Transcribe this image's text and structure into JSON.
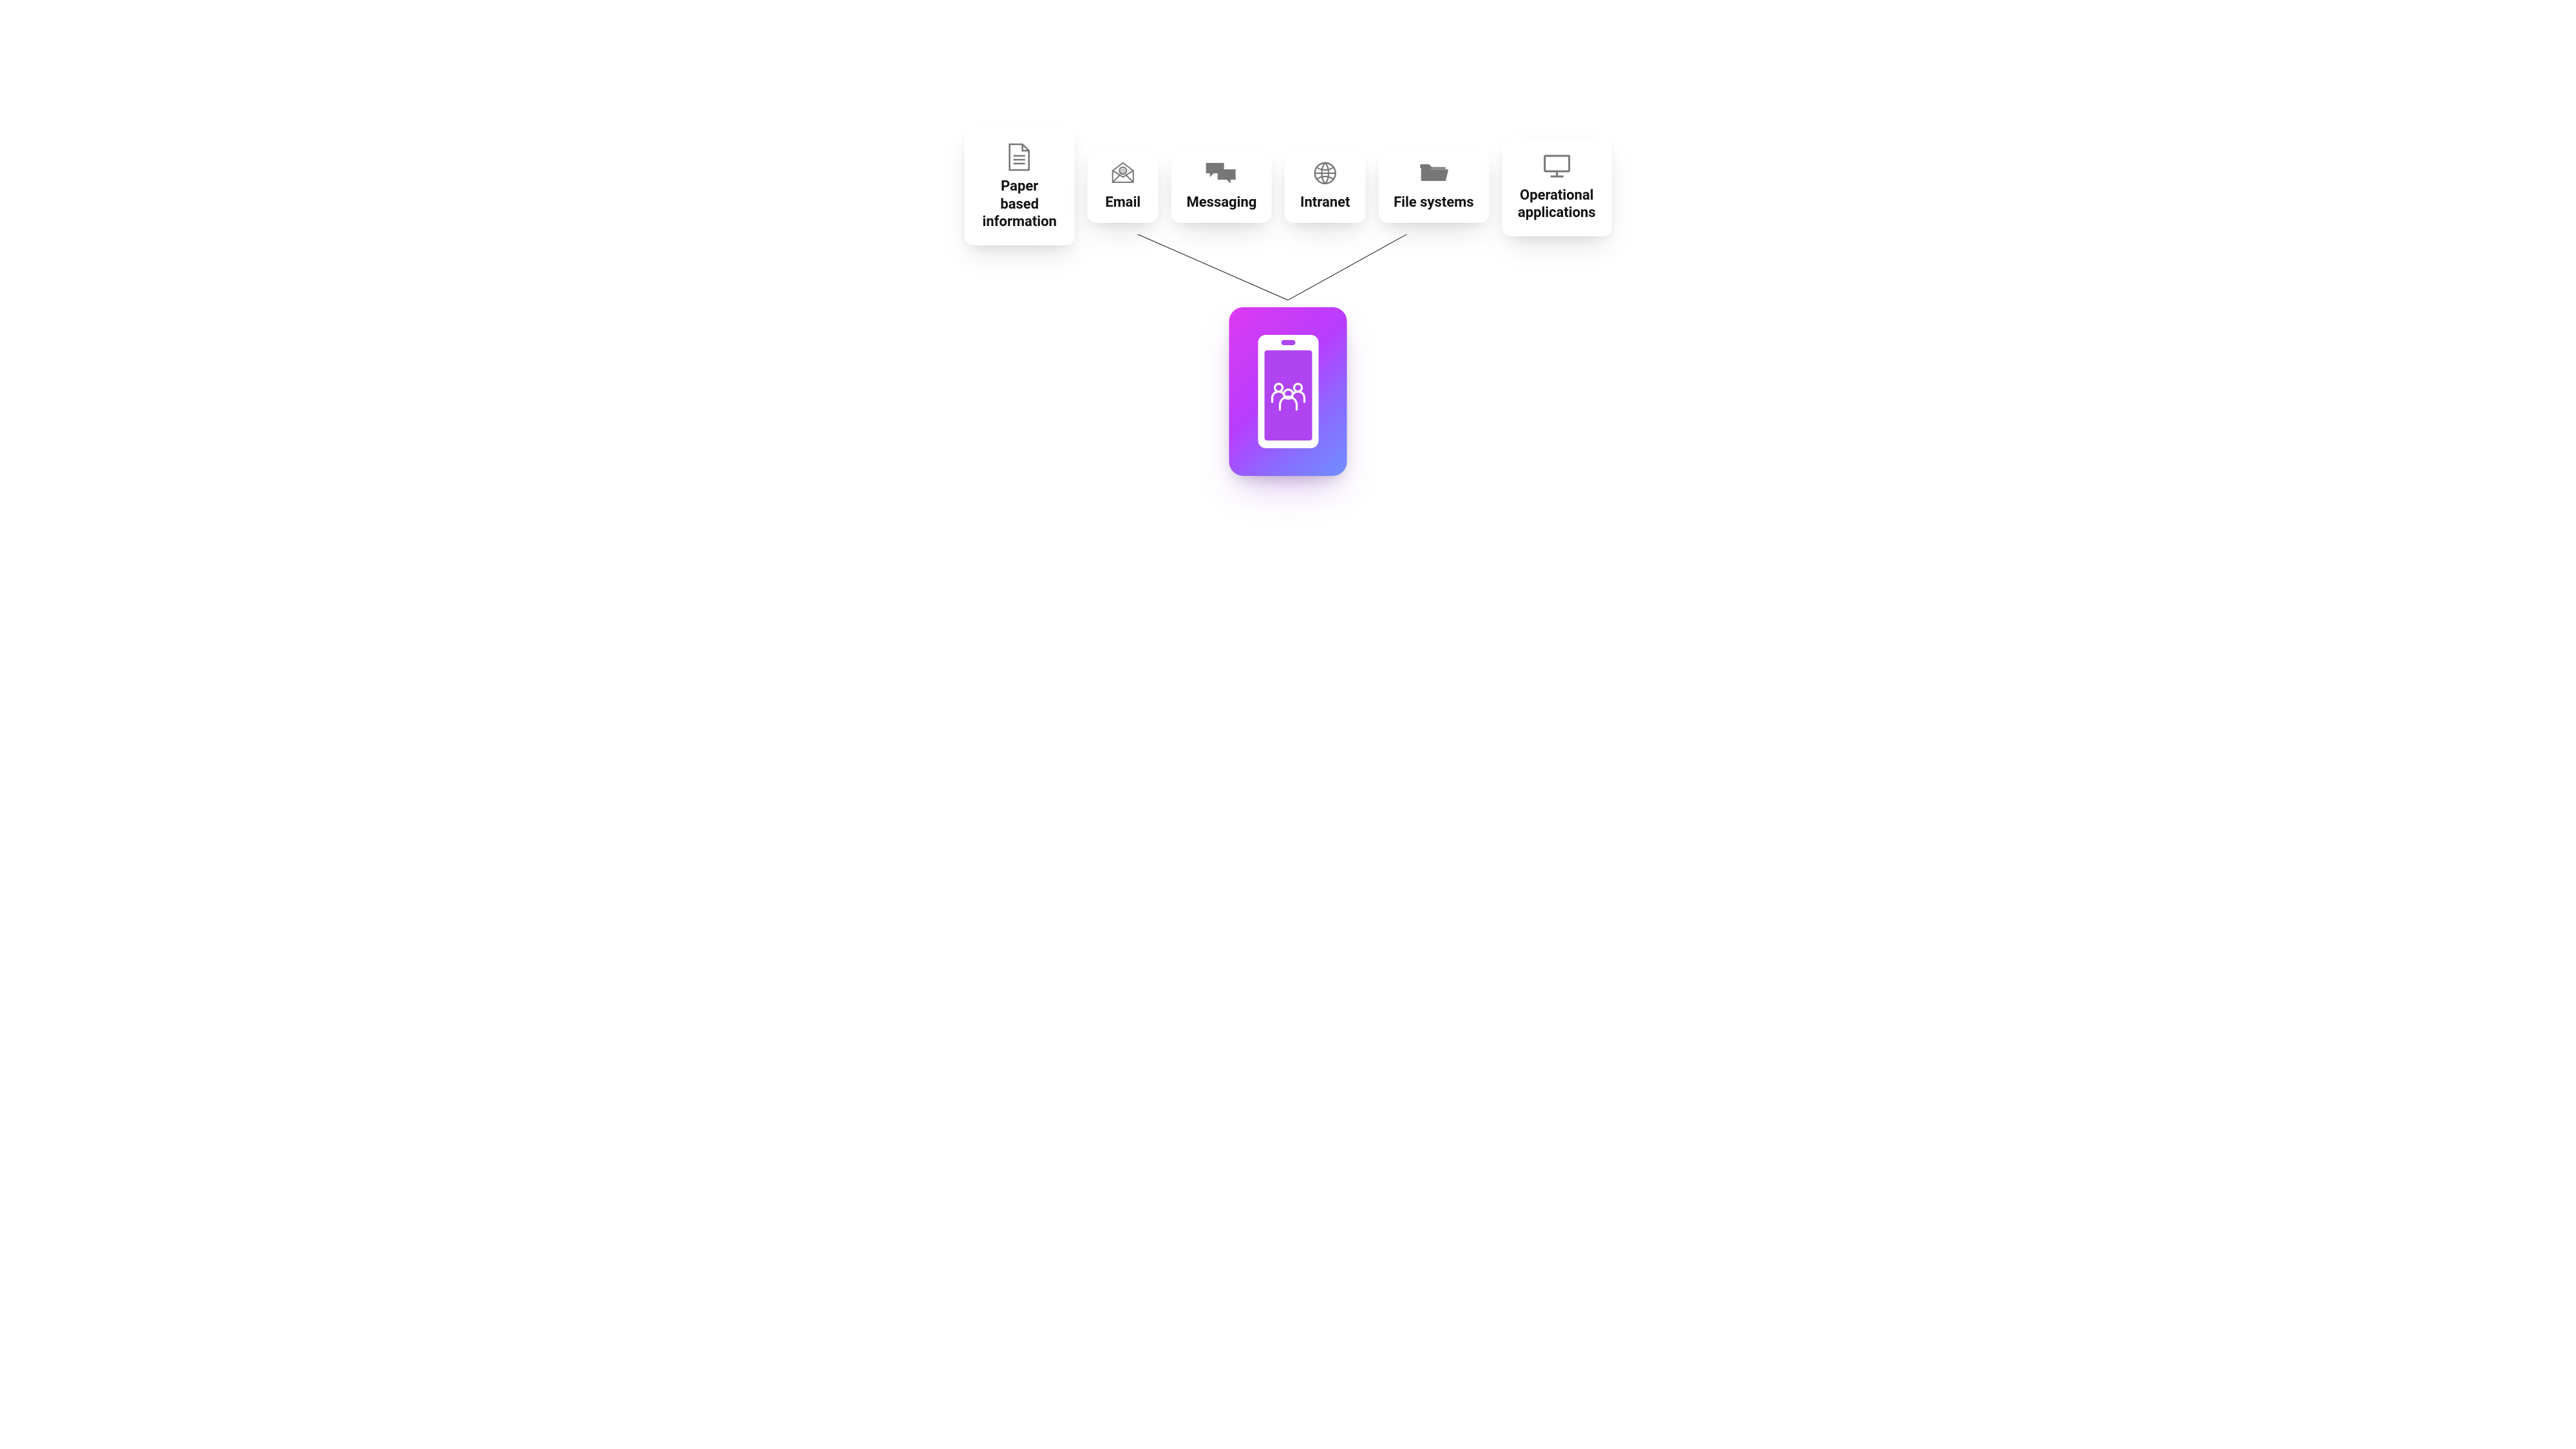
{
  "sources": {
    "paper": {
      "label_line1": "Paper based",
      "label_line2": "information",
      "icon": "document-icon"
    },
    "email": {
      "label": "Email",
      "icon": "email-icon"
    },
    "messaging": {
      "label": "Messaging",
      "icon": "chat-icon"
    },
    "intranet": {
      "label": "Intranet",
      "icon": "globe-icon"
    },
    "filesystems": {
      "label": "File systems",
      "icon": "folder-icon"
    },
    "operational": {
      "label_line1": "Operational",
      "label_line2": "applications",
      "icon": "monitor-icon"
    }
  },
  "hub": {
    "icon": "mobile-people-icon"
  }
}
